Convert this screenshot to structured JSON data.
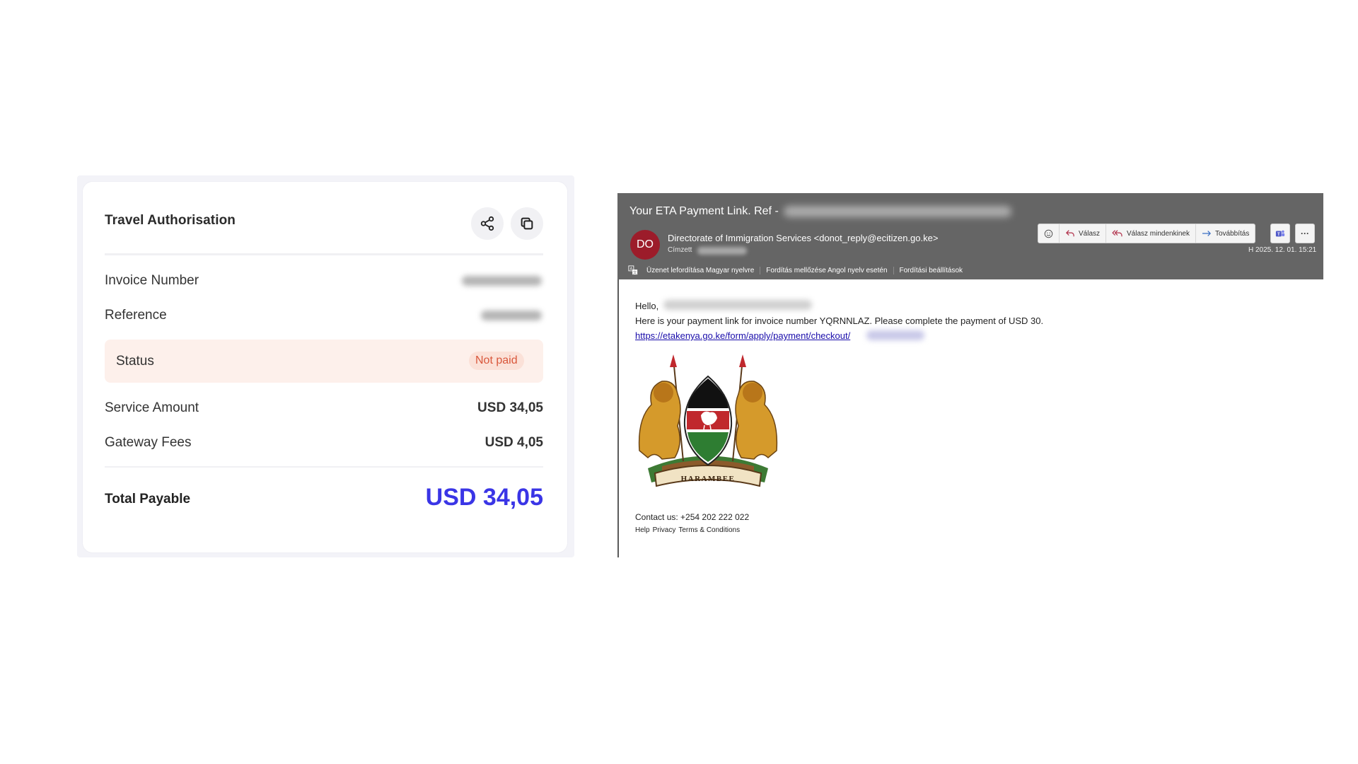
{
  "invoice_card": {
    "title": "Travel Authorisation",
    "share_icon": "share-icon",
    "copy_icon": "copy-icon",
    "invoice_number_label": "Invoice Number",
    "reference_label": "Reference",
    "status_label": "Status",
    "status_value": "Not paid",
    "service_amount_label": "Service Amount",
    "service_amount_value": "USD 34,05",
    "gateway_fees_label": "Gateway Fees",
    "gateway_fees_value": "USD 4,05",
    "total_label": "Total Payable",
    "total_value": "USD 34,05",
    "colors": {
      "accent": "#3a35e6",
      "status_bg": "#fdf0eb",
      "status_text": "#d9573b"
    }
  },
  "email": {
    "subject": "Your ETA Payment Link. Ref - ",
    "avatar_initials": "DO",
    "sender": "Directorate of Immigration Services <donot_reply@ecitizen.go.ke>",
    "to_label": "Címzett",
    "actions": {
      "emoji": "emoji-icon",
      "reply": "Válasz",
      "reply_all": "Válasz mindenkinek",
      "forward": "Továbbítás",
      "teams": "teams-icon",
      "more": "···"
    },
    "date": "H 2025. 12. 01.  15:21",
    "translate_bar": {
      "translate": "Üzenet lefordítása Magyar nyelvre",
      "never_translate": "Fordítás mellőzése Angol nyelv esetén",
      "settings": "Fordítási beállítások"
    },
    "body": {
      "greeting": "Hello,",
      "line1": "Here is your payment link for invoice number YQRNNLAZ. Please complete the payment of USD 30.",
      "link": "https://etakenya.go.ke/form/apply/payment/checkout/",
      "motto": "HARAMBEE",
      "contact": "Contact us: +254 202 222 022",
      "footer": {
        "help": "Help",
        "privacy": "Privacy",
        "terms": "Terms & Conditions"
      }
    },
    "colors": {
      "header_bg": "#656565",
      "avatar_bg": "#9c1c2a",
      "link": "#1a0dab"
    }
  }
}
